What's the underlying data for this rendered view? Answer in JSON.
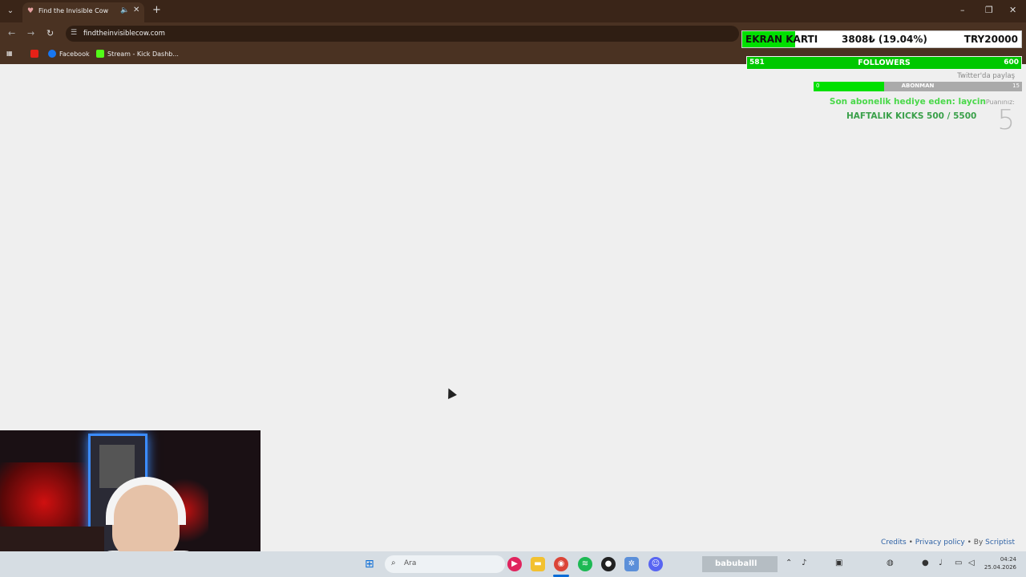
{
  "browser": {
    "tab_title": "Find the Invisible Cow",
    "url": "findtheinvisiblecow.com",
    "bookmarks": [
      "Facebook",
      "Stream - Kick Dashb..."
    ]
  },
  "overlay": {
    "goal_name": "EKRAN KARTI",
    "goal_current": "3808₺ (19.04%)",
    "goal_target": "TRY20000",
    "goal_fraction": 0.1904,
    "followers_current": "581",
    "followers_label": "FOLLOWERS",
    "followers_max": "600",
    "twitter_text": "Twitter'da paylaş",
    "sub_zero": "0",
    "sub_label": "ABONMAN",
    "sub_max": "15",
    "gift_text": "Son abonelik hediye eden: laycin",
    "kicks_text": "HAFTALIK KICKS 500 / 5500"
  },
  "game": {
    "score_label": "Puanınız:",
    "score_value": "5"
  },
  "footer": {
    "credits": "Credits",
    "privacy": "Privacy policy",
    "by": "• By",
    "author": "Scriptist",
    "sep": "•"
  },
  "taskbar": {
    "search_placeholder": "Ara",
    "tray_user": "babuballl",
    "time": "04:24",
    "date": "25.04.2026"
  },
  "colors": {
    "goal_green": "#00e000",
    "followers_green": "#00c800",
    "gift_green": "#4ad84a",
    "link_blue": "#2f62a5",
    "browser_chrome": "#4a3222"
  }
}
